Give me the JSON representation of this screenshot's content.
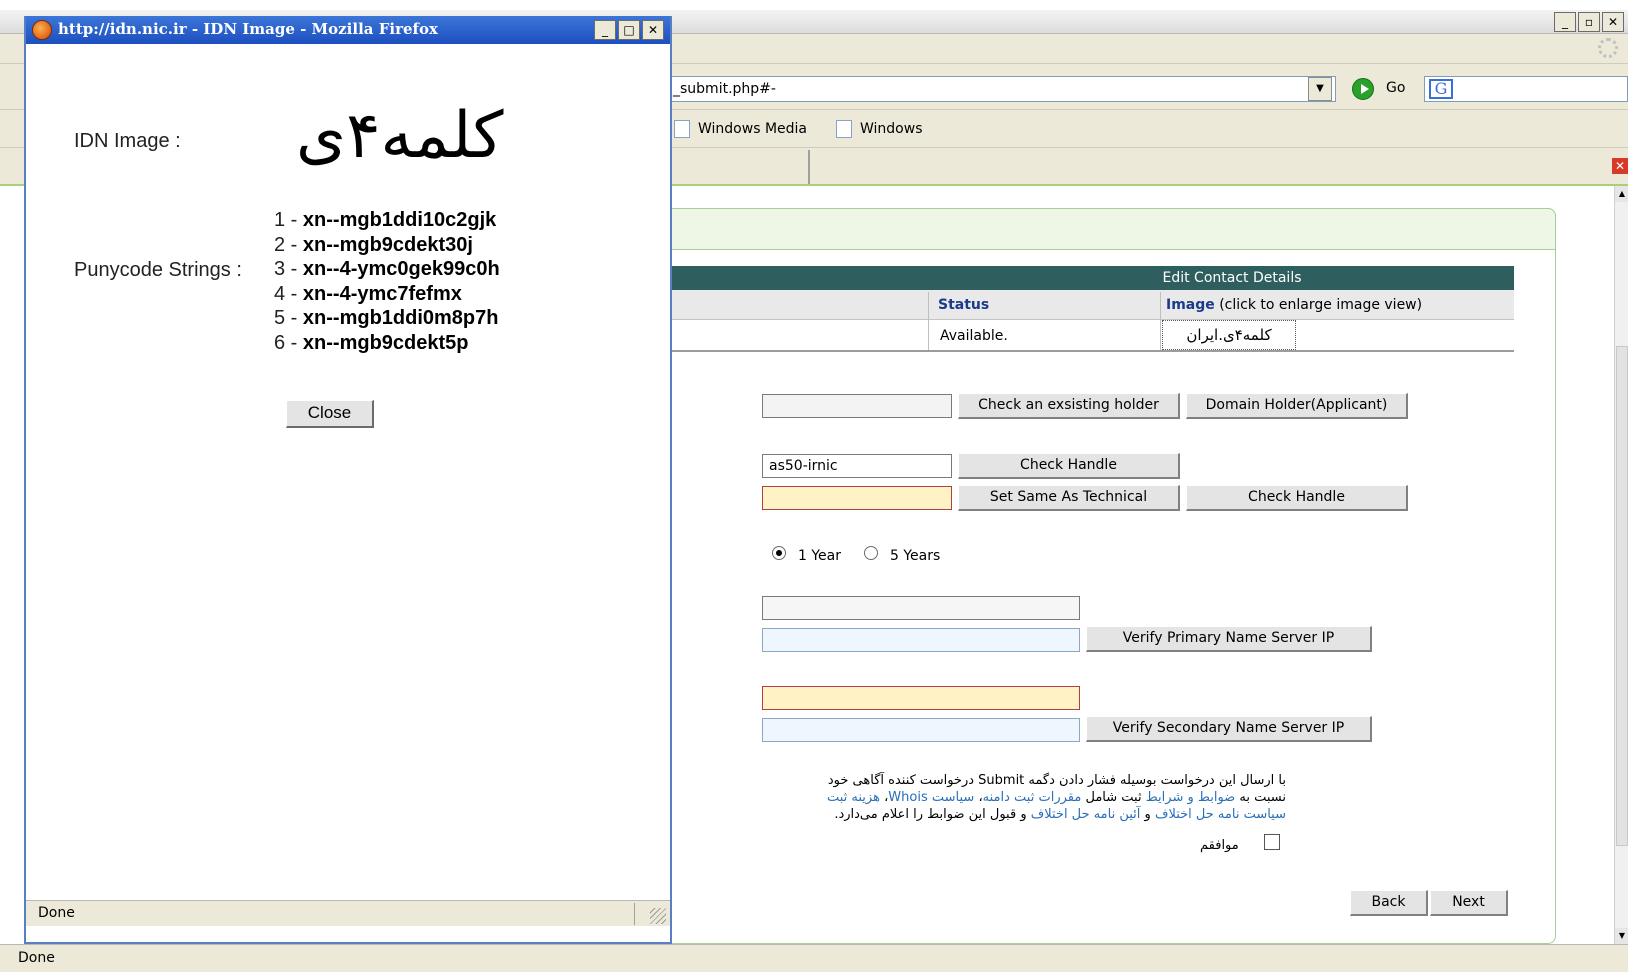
{
  "browser": {
    "url_partial": "_submit.php#-",
    "go_label": "Go",
    "bookmarks": [
      "Windows Media",
      "Windows"
    ],
    "status": "Done",
    "window_buttons": [
      "_",
      "□",
      "✕"
    ]
  },
  "page": {
    "table": {
      "header": "Edit Contact Details",
      "col_status": "Status",
      "col_image_bold": "Image",
      "col_image_note": "(click to enlarge image view)",
      "status_value": "Available.",
      "image_value": "کلمه۴ی.ایران"
    },
    "holder": {
      "input_value": "",
      "check_existing": "Check an exsisting holder",
      "domain_holder": "Domain Holder(Applicant)"
    },
    "technical": {
      "handle_value": "as50-irnic",
      "check_handle": "Check Handle"
    },
    "admin": {
      "handle_value": "",
      "set_same": "Set Same As Technical",
      "check_handle": "Check Handle"
    },
    "period": {
      "option_1": "1 Year",
      "option_2": "5 Years",
      "selected": "1 Year"
    },
    "name_servers": {
      "primary_btn": "Verify Primary Name Server IP",
      "secondary_btn": "Verify Secondary Name Server IP"
    },
    "terms": {
      "line1": "با ارسال این درخواست بوسیله فشار دادن دگمه Submit درخواست کننده آگاهی خود",
      "line2_pre": "نسبت به",
      "line2_link1": "ضوابط و شرایط",
      "line2_mid": "ثبت شامل",
      "line2_link2": "مقررات ثبت دامنه",
      "line2_sep": "،",
      "line2_link3": "سیاست Whois",
      "line2_sep2": "،",
      "line2_link4": "هزینه ثبت",
      "line3_link1": "سیاست نامه حل اختلاف",
      "line3_and": "و",
      "line3_link2": "آئین نامه حل اختلاف",
      "line3_post": "و قبول این ضوابط را اعلام می‌دارد.",
      "agree": "موافقم"
    },
    "nav": {
      "back": "Back",
      "next": "Next"
    }
  },
  "popup": {
    "title": "http://idn.nic.ir - IDN Image - Mozilla Firefox",
    "idn_label": "IDN Image :",
    "idn_text": "کلمه۴ی",
    "puny_label": "Punycode Strings :",
    "punycodes": [
      {
        "num": "1 - ",
        "code": "xn--mgb1ddi10c2gjk"
      },
      {
        "num": "2 - ",
        "code": "xn--mgb9cdekt30j"
      },
      {
        "num": "3 - ",
        "code": "xn--4-ymc0gek99c0h"
      },
      {
        "num": "4 - ",
        "code": "xn--4-ymc7fefmx"
      },
      {
        "num": "5 - ",
        "code": "xn--mgb1ddi0m8p7h"
      },
      {
        "num": "6 - ",
        "code": "xn--mgb9cdekt5p"
      }
    ],
    "close_label": "Close",
    "status": "Done"
  }
}
